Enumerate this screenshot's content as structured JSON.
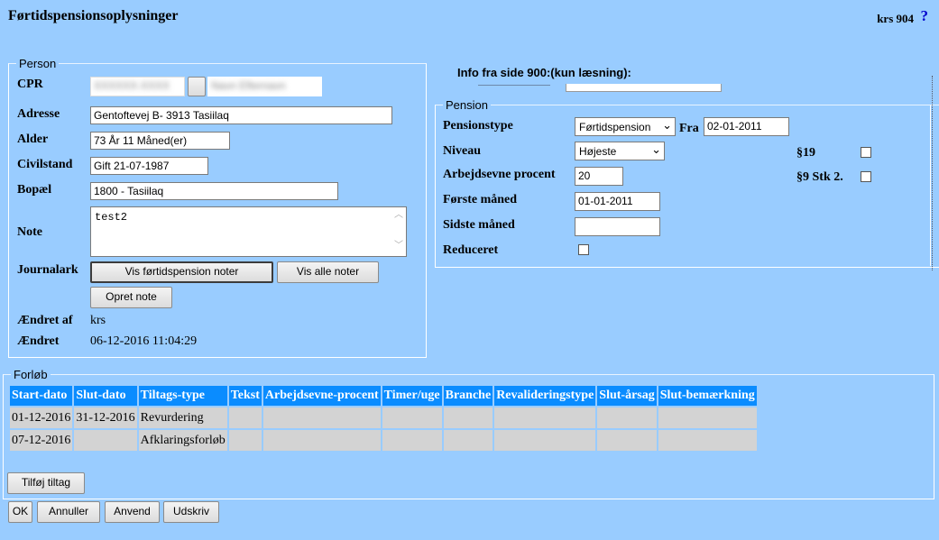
{
  "window": {
    "title": "Førtidspensionsoplysninger",
    "code": "krs 904",
    "help": "?"
  },
  "person": {
    "legend": "Person",
    "cpr_label": "CPR",
    "cpr_value": "XXXXXX-XXXX",
    "cpr_name": "Navn Efternavn",
    "address_label": "Adresse",
    "address_value": "Gentoftevej B-     3913  Tasiilaq",
    "age_label": "Alder",
    "age_value": "73 År 11 Måned(er)",
    "civil_label": "Civilstand",
    "civil_value": "Gift 21-07-1987",
    "residence_label": "Bopæl",
    "residence_value": "1800 - Tasiilaq",
    "note_label": "Note",
    "note_value": "test2",
    "journal_label": "Journalark",
    "btn_show_notes": "Vis førtidspension noter",
    "btn_show_all": "Vis alle noter",
    "btn_create_note": "Opret note",
    "changed_by_label": "Ændret af",
    "changed_by_value": "krs",
    "changed_label": "Ændret",
    "changed_value": "06-12-2016 11:04:29"
  },
  "info900": {
    "label": "Info fra side 900:(kun læsning):"
  },
  "pension": {
    "legend": "Pension",
    "type_label": "Pensionstype",
    "type_value": "Førtidspension",
    "from_label": "Fra",
    "from_value": "02-01-2011",
    "level_label": "Niveau",
    "level_value": "Højeste",
    "par19_label": "§19",
    "par9_label": "§9 Stk 2.",
    "capacity_label": "Arbejdsevne procent",
    "capacity_value": "20",
    "first_month_label": "Første måned",
    "first_month_value": "01-01-2011",
    "last_month_label": "Sidste måned",
    "last_month_value": "",
    "reduced_label": "Reduceret"
  },
  "course": {
    "legend": "Forløb",
    "columns": [
      "Start-dato",
      "Slut-dato",
      "Tiltags-type",
      "Tekst",
      "Arbejdsevne-procent",
      "Timer/uge",
      "Branche",
      "Revalideringstype",
      "Slut-årsag",
      "Slut-bemærkning"
    ],
    "rows": [
      [
        "01-12-2016",
        "31-12-2016",
        "Revurdering",
        "",
        "",
        "",
        "",
        "",
        "",
        ""
      ],
      [
        "07-12-2016",
        "",
        "Afklaringsforløb",
        "",
        "",
        "",
        "",
        "",
        "",
        ""
      ]
    ],
    "btn_add": "Tilføj tiltag"
  },
  "footer": {
    "ok": "OK",
    "cancel": "Annuller",
    "apply": "Anvend",
    "print": "Udskriv"
  }
}
